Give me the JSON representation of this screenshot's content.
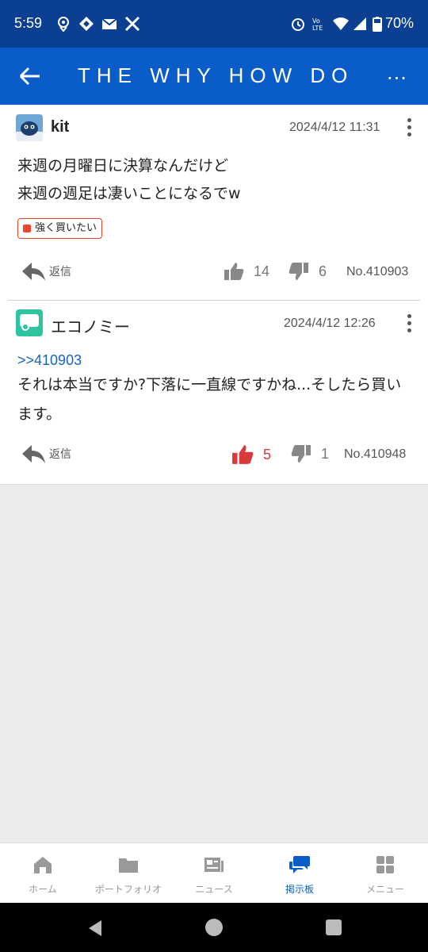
{
  "status_bar": {
    "time": "5:59",
    "battery": "70%",
    "icons_left": [
      "location-icon",
      "diamond-icon",
      "mail-icon",
      "x-logo-icon"
    ],
    "icons_right": [
      "alarm-icon",
      "volte-icon",
      "wifi-icon",
      "signal-icon",
      "battery-icon"
    ]
  },
  "app_bar": {
    "title": "THE WHY HOW DO",
    "more": "..."
  },
  "posts": [
    {
      "username": "kit",
      "date": "2024/4/12 11:31",
      "lines": [
        "来週の月曜日に決算なんだけど",
        "来週の週足は凄いことになるでw"
      ],
      "tag": "強く買いたい",
      "reply_label": "返信",
      "likes": "14",
      "dislikes": "6",
      "post_no": "No.410903"
    },
    {
      "username": "エコノミー",
      "date": "2024/4/12 12:26",
      "quote": ">>410903",
      "lines": [
        "それは本当ですか?下落に一直線ですかね...そしたら買い",
        "ます。"
      ],
      "reply_label": "返信",
      "likes": "5",
      "dislikes": "1",
      "post_no": "No.410948"
    }
  ],
  "bottom_nav": [
    {
      "label": "ホーム",
      "icon": "home-icon"
    },
    {
      "label": "ポートフォリオ",
      "icon": "folder-icon"
    },
    {
      "label": "ニュース",
      "icon": "newspaper-icon"
    },
    {
      "label": "掲示板",
      "icon": "chat-icon"
    },
    {
      "label": "メニュー",
      "icon": "grid-icon"
    }
  ],
  "colors": {
    "status_bar": "#0b3f92",
    "app_bar": "#0a5dc8",
    "accent": "#0a5dc8",
    "like_active": "#d63a3a",
    "tag_border": "#e4432d"
  }
}
